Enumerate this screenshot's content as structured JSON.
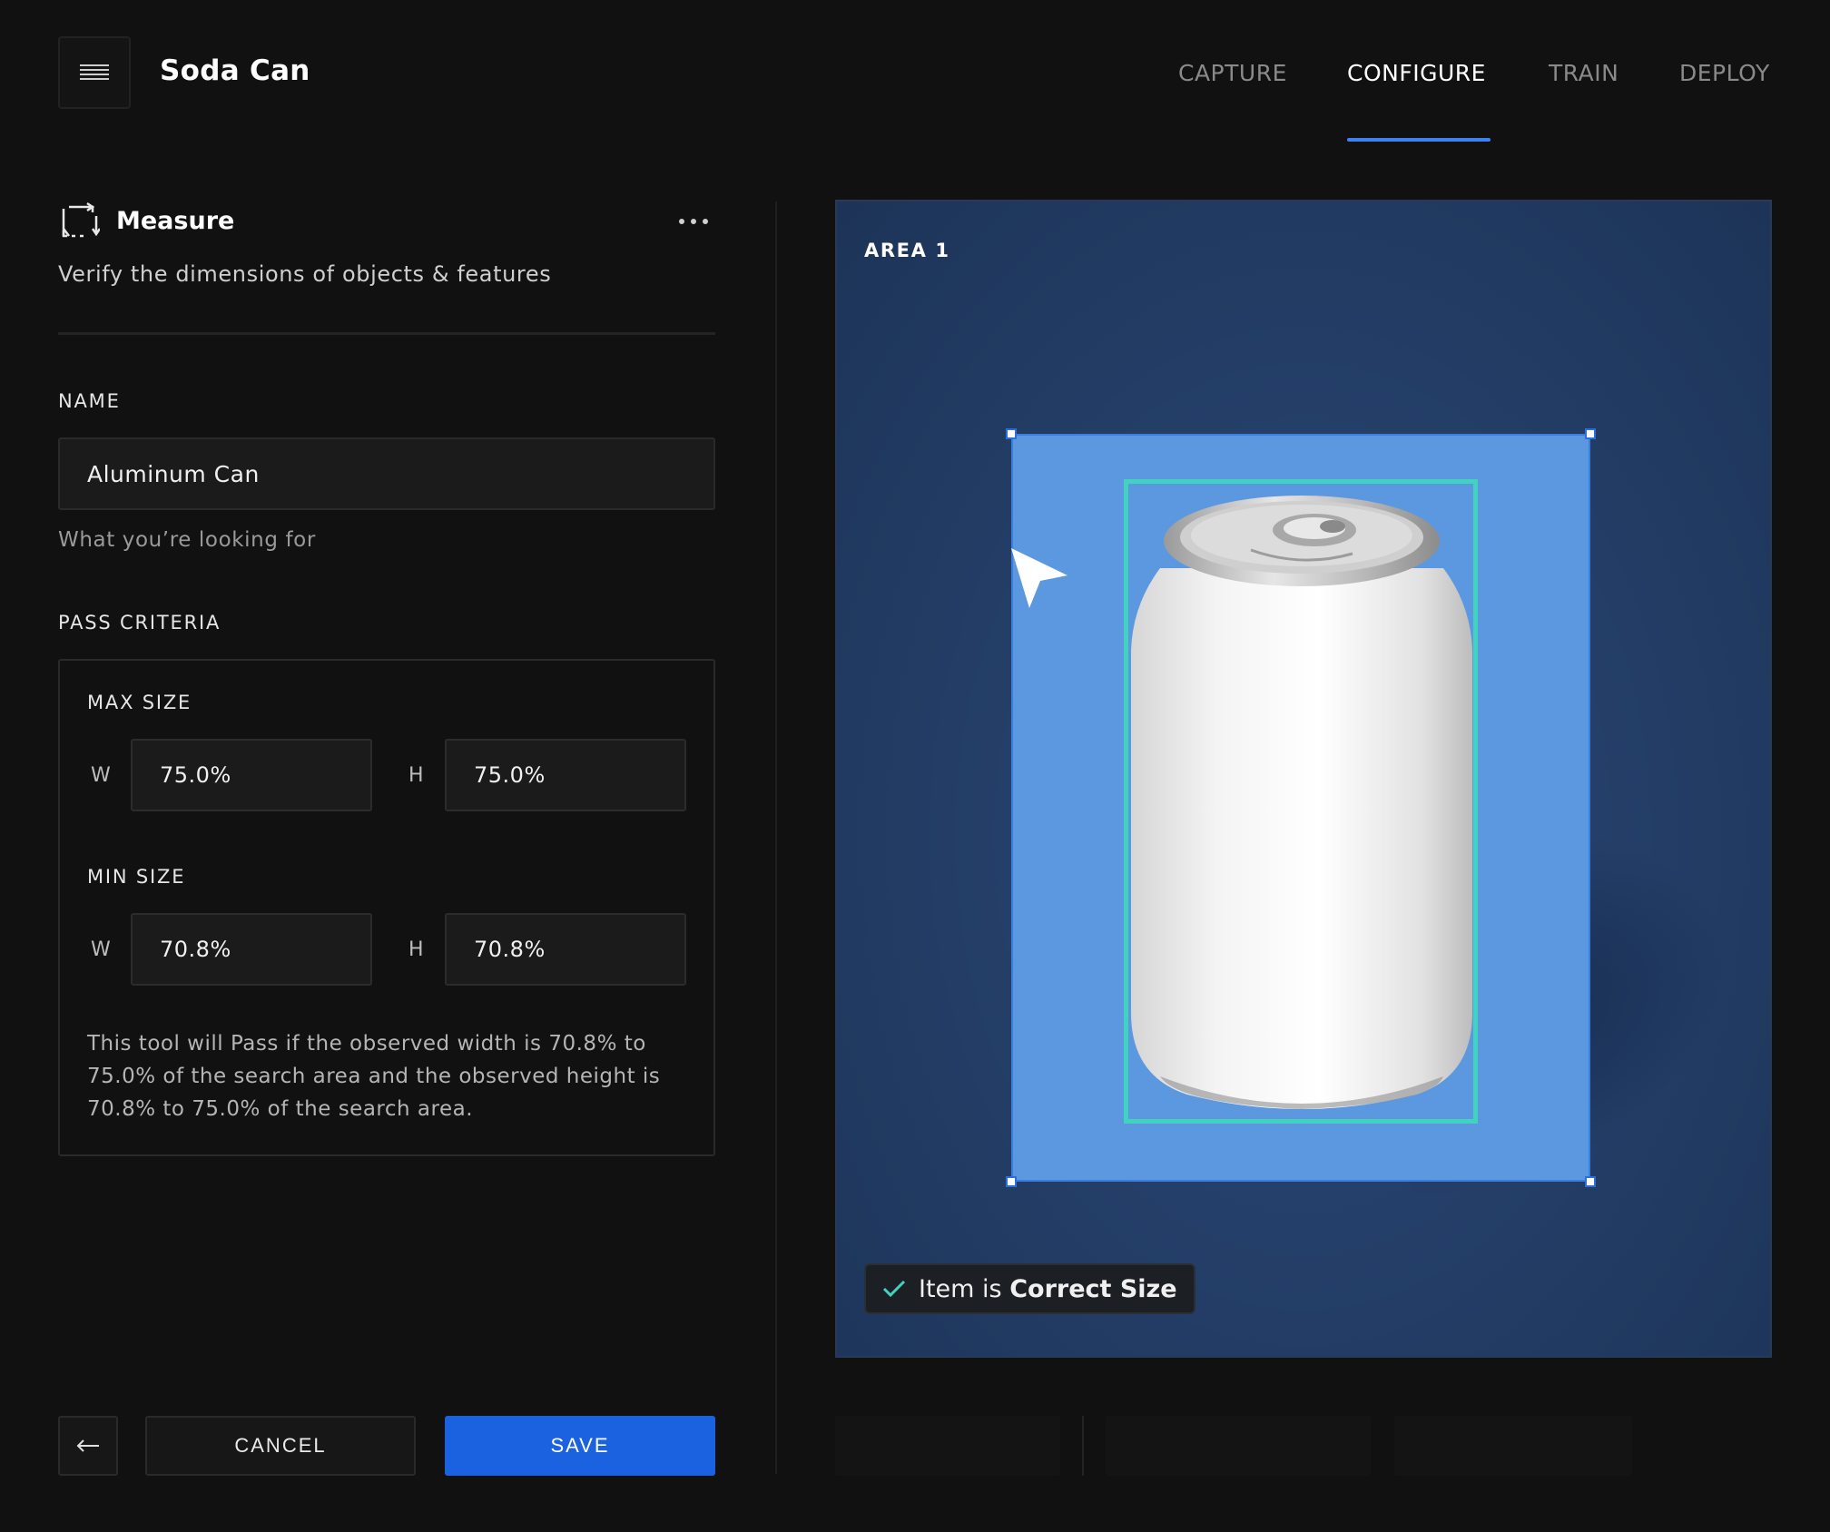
{
  "header": {
    "title": "Soda Can",
    "tabs": [
      {
        "label": "CAPTURE",
        "active": false
      },
      {
        "label": "CONFIGURE",
        "active": true
      },
      {
        "label": "TRAIN",
        "active": false
      },
      {
        "label": "DEPLOY",
        "active": false
      }
    ]
  },
  "panel": {
    "title": "Measure",
    "description": "Verify the dimensions of objects & features",
    "name_label": "NAME",
    "name_value": "Aluminum Can",
    "name_help": "What you’re looking for",
    "criteria_label": "PASS CRITERIA",
    "max_size": {
      "label": "MAX SIZE",
      "w_label": "W",
      "w_value": "75.0%",
      "h_label": "H",
      "h_value": "75.0%"
    },
    "min_size": {
      "label": "MIN SIZE",
      "w_label": "W",
      "w_value": "70.8%",
      "h_label": "H",
      "h_value": "70.8%"
    },
    "rule_text": "This tool will Pass if the observed width is 70.8% to 75.0% of the search area and the observed height is 70.8% to 75.0% of the search area."
  },
  "footer": {
    "cancel_label": "CANCEL",
    "save_label": "SAVE"
  },
  "viewer": {
    "area_label": "AREA 1",
    "status_prefix": "Item is",
    "status_emphasis": "Correct Size"
  },
  "colors": {
    "accent": "#3b82f6",
    "save_button": "#1a62e0",
    "search_area": "#5b98df",
    "detection_box": "#41d3c0",
    "status_check": "#41d3c0"
  },
  "icons": {
    "menu": "menu-icon",
    "measure": "measure-icon",
    "more": "more-horizontal-icon",
    "back": "arrow-left-icon",
    "cursor": "cursor-arrow-icon",
    "check": "check-icon"
  }
}
